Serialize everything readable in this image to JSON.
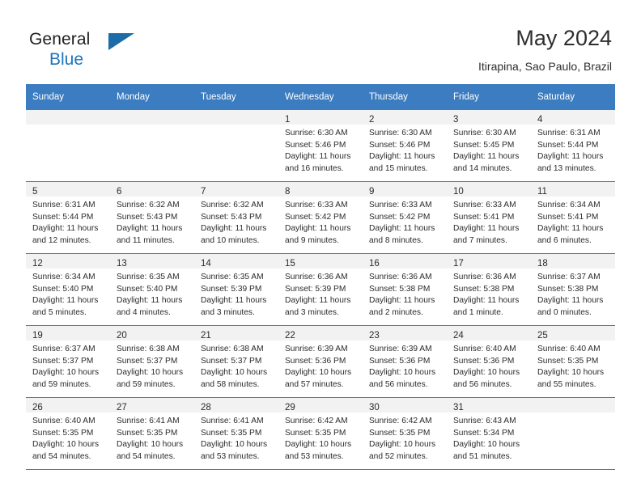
{
  "brand": {
    "name_part1": "General",
    "name_part2": "Blue",
    "triangle_color": "#1b6ca8",
    "blue_color": "#1c75bc"
  },
  "header": {
    "title": "May 2024",
    "subtitle": "Itirapina, Sao Paulo, Brazil"
  },
  "theme": {
    "header_bar_color": "#3c7cc0",
    "daynum_band_color": "#f2f2f2",
    "text_color": "#2b2b2b"
  },
  "weekday_headers": [
    "Sunday",
    "Monday",
    "Tuesday",
    "Wednesday",
    "Thursday",
    "Friday",
    "Saturday"
  ],
  "weeks": [
    [
      {
        "empty": true
      },
      {
        "empty": true
      },
      {
        "empty": true
      },
      {
        "day": "1",
        "sunrise": "Sunrise: 6:30 AM",
        "sunset": "Sunset: 5:46 PM",
        "daylight1": "Daylight: 11 hours",
        "daylight2": "and 16 minutes."
      },
      {
        "day": "2",
        "sunrise": "Sunrise: 6:30 AM",
        "sunset": "Sunset: 5:46 PM",
        "daylight1": "Daylight: 11 hours",
        "daylight2": "and 15 minutes."
      },
      {
        "day": "3",
        "sunrise": "Sunrise: 6:30 AM",
        "sunset": "Sunset: 5:45 PM",
        "daylight1": "Daylight: 11 hours",
        "daylight2": "and 14 minutes."
      },
      {
        "day": "4",
        "sunrise": "Sunrise: 6:31 AM",
        "sunset": "Sunset: 5:44 PM",
        "daylight1": "Daylight: 11 hours",
        "daylight2": "and 13 minutes."
      }
    ],
    [
      {
        "day": "5",
        "sunrise": "Sunrise: 6:31 AM",
        "sunset": "Sunset: 5:44 PM",
        "daylight1": "Daylight: 11 hours",
        "daylight2": "and 12 minutes."
      },
      {
        "day": "6",
        "sunrise": "Sunrise: 6:32 AM",
        "sunset": "Sunset: 5:43 PM",
        "daylight1": "Daylight: 11 hours",
        "daylight2": "and 11 minutes."
      },
      {
        "day": "7",
        "sunrise": "Sunrise: 6:32 AM",
        "sunset": "Sunset: 5:43 PM",
        "daylight1": "Daylight: 11 hours",
        "daylight2": "and 10 minutes."
      },
      {
        "day": "8",
        "sunrise": "Sunrise: 6:33 AM",
        "sunset": "Sunset: 5:42 PM",
        "daylight1": "Daylight: 11 hours",
        "daylight2": "and 9 minutes."
      },
      {
        "day": "9",
        "sunrise": "Sunrise: 6:33 AM",
        "sunset": "Sunset: 5:42 PM",
        "daylight1": "Daylight: 11 hours",
        "daylight2": "and 8 minutes."
      },
      {
        "day": "10",
        "sunrise": "Sunrise: 6:33 AM",
        "sunset": "Sunset: 5:41 PM",
        "daylight1": "Daylight: 11 hours",
        "daylight2": "and 7 minutes."
      },
      {
        "day": "11",
        "sunrise": "Sunrise: 6:34 AM",
        "sunset": "Sunset: 5:41 PM",
        "daylight1": "Daylight: 11 hours",
        "daylight2": "and 6 minutes."
      }
    ],
    [
      {
        "day": "12",
        "sunrise": "Sunrise: 6:34 AM",
        "sunset": "Sunset: 5:40 PM",
        "daylight1": "Daylight: 11 hours",
        "daylight2": "and 5 minutes."
      },
      {
        "day": "13",
        "sunrise": "Sunrise: 6:35 AM",
        "sunset": "Sunset: 5:40 PM",
        "daylight1": "Daylight: 11 hours",
        "daylight2": "and 4 minutes."
      },
      {
        "day": "14",
        "sunrise": "Sunrise: 6:35 AM",
        "sunset": "Sunset: 5:39 PM",
        "daylight1": "Daylight: 11 hours",
        "daylight2": "and 3 minutes."
      },
      {
        "day": "15",
        "sunrise": "Sunrise: 6:36 AM",
        "sunset": "Sunset: 5:39 PM",
        "daylight1": "Daylight: 11 hours",
        "daylight2": "and 3 minutes."
      },
      {
        "day": "16",
        "sunrise": "Sunrise: 6:36 AM",
        "sunset": "Sunset: 5:38 PM",
        "daylight1": "Daylight: 11 hours",
        "daylight2": "and 2 minutes."
      },
      {
        "day": "17",
        "sunrise": "Sunrise: 6:36 AM",
        "sunset": "Sunset: 5:38 PM",
        "daylight1": "Daylight: 11 hours",
        "daylight2": "and 1 minute."
      },
      {
        "day": "18",
        "sunrise": "Sunrise: 6:37 AM",
        "sunset": "Sunset: 5:38 PM",
        "daylight1": "Daylight: 11 hours",
        "daylight2": "and 0 minutes."
      }
    ],
    [
      {
        "day": "19",
        "sunrise": "Sunrise: 6:37 AM",
        "sunset": "Sunset: 5:37 PM",
        "daylight1": "Daylight: 10 hours",
        "daylight2": "and 59 minutes."
      },
      {
        "day": "20",
        "sunrise": "Sunrise: 6:38 AM",
        "sunset": "Sunset: 5:37 PM",
        "daylight1": "Daylight: 10 hours",
        "daylight2": "and 59 minutes."
      },
      {
        "day": "21",
        "sunrise": "Sunrise: 6:38 AM",
        "sunset": "Sunset: 5:37 PM",
        "daylight1": "Daylight: 10 hours",
        "daylight2": "and 58 minutes."
      },
      {
        "day": "22",
        "sunrise": "Sunrise: 6:39 AM",
        "sunset": "Sunset: 5:36 PM",
        "daylight1": "Daylight: 10 hours",
        "daylight2": "and 57 minutes."
      },
      {
        "day": "23",
        "sunrise": "Sunrise: 6:39 AM",
        "sunset": "Sunset: 5:36 PM",
        "daylight1": "Daylight: 10 hours",
        "daylight2": "and 56 minutes."
      },
      {
        "day": "24",
        "sunrise": "Sunrise: 6:40 AM",
        "sunset": "Sunset: 5:36 PM",
        "daylight1": "Daylight: 10 hours",
        "daylight2": "and 56 minutes."
      },
      {
        "day": "25",
        "sunrise": "Sunrise: 6:40 AM",
        "sunset": "Sunset: 5:35 PM",
        "daylight1": "Daylight: 10 hours",
        "daylight2": "and 55 minutes."
      }
    ],
    [
      {
        "day": "26",
        "sunrise": "Sunrise: 6:40 AM",
        "sunset": "Sunset: 5:35 PM",
        "daylight1": "Daylight: 10 hours",
        "daylight2": "and 54 minutes."
      },
      {
        "day": "27",
        "sunrise": "Sunrise: 6:41 AM",
        "sunset": "Sunset: 5:35 PM",
        "daylight1": "Daylight: 10 hours",
        "daylight2": "and 54 minutes."
      },
      {
        "day": "28",
        "sunrise": "Sunrise: 6:41 AM",
        "sunset": "Sunset: 5:35 PM",
        "daylight1": "Daylight: 10 hours",
        "daylight2": "and 53 minutes."
      },
      {
        "day": "29",
        "sunrise": "Sunrise: 6:42 AM",
        "sunset": "Sunset: 5:35 PM",
        "daylight1": "Daylight: 10 hours",
        "daylight2": "and 53 minutes."
      },
      {
        "day": "30",
        "sunrise": "Sunrise: 6:42 AM",
        "sunset": "Sunset: 5:35 PM",
        "daylight1": "Daylight: 10 hours",
        "daylight2": "and 52 minutes."
      },
      {
        "day": "31",
        "sunrise": "Sunrise: 6:43 AM",
        "sunset": "Sunset: 5:34 PM",
        "daylight1": "Daylight: 10 hours",
        "daylight2": "and 51 minutes."
      },
      {
        "empty": true
      }
    ]
  ]
}
